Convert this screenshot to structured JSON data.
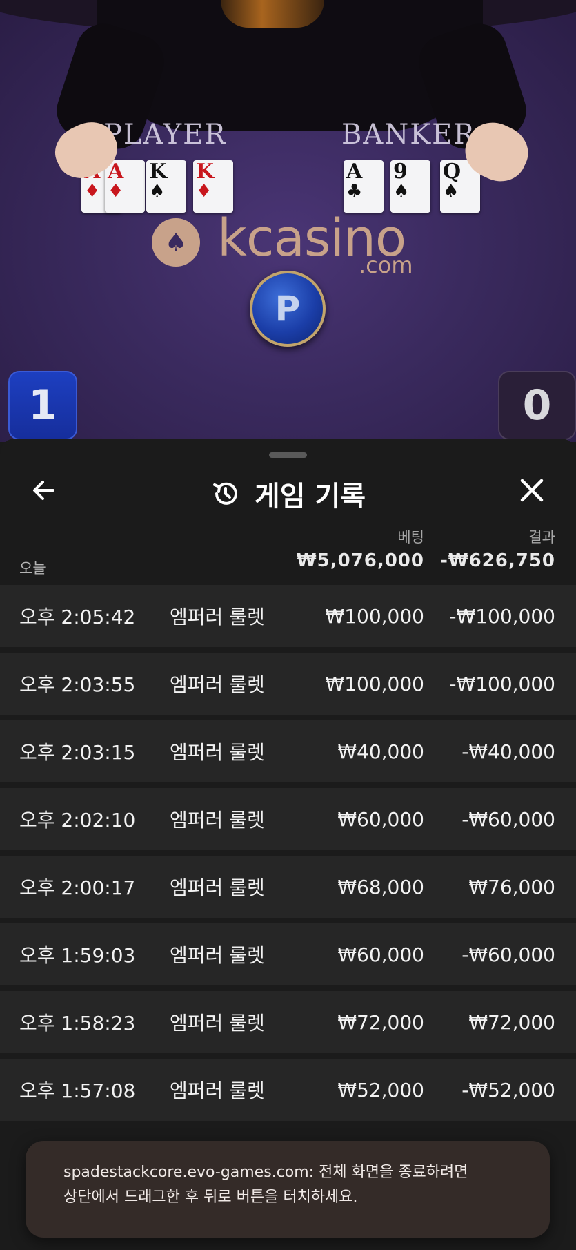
{
  "video": {
    "player_label": "PLAYER",
    "banker_label": "BANKER",
    "player_cards": [
      {
        "rank": "A",
        "suit": "♦",
        "color": "red"
      },
      {
        "rank": "A",
        "suit": "♦",
        "color": "red"
      },
      {
        "rank": "K",
        "suit": "♠",
        "color": "black"
      },
      {
        "rank": "K",
        "suit": "♦",
        "color": "red"
      }
    ],
    "banker_cards": [
      {
        "rank": "A",
        "suit": "♣",
        "color": "black"
      },
      {
        "rank": "9",
        "suit": "♠",
        "color": "black"
      },
      {
        "rank": "Q",
        "suit": "♠",
        "color": "black"
      }
    ],
    "logo_text": "kcasino",
    "logo_suffix": ".com",
    "winner_token": "P",
    "player_score": "1",
    "banker_score": "0"
  },
  "sheet": {
    "title": "게임 기록",
    "history_icon": "history-icon",
    "back_icon": "back-arrow-icon",
    "close_icon": "close-icon",
    "column_bet": "베팅",
    "column_result": "결과",
    "today_label": "오늘",
    "total_bet": "₩5,076,000",
    "total_result": "-₩626,750",
    "rows": [
      {
        "time": "오후 2:05:42",
        "game": "엠퍼러 룰렛",
        "bet": "₩100,000",
        "result": "-₩100,000"
      },
      {
        "time": "오후 2:03:55",
        "game": "엠퍼러 룰렛",
        "bet": "₩100,000",
        "result": "-₩100,000"
      },
      {
        "time": "오후 2:03:15",
        "game": "엠퍼러 룰렛",
        "bet": "₩40,000",
        "result": "-₩40,000"
      },
      {
        "time": "오후 2:02:10",
        "game": "엠퍼러 룰렛",
        "bet": "₩60,000",
        "result": "-₩60,000"
      },
      {
        "time": "오후 2:00:17",
        "game": "엠퍼러 룰렛",
        "bet": "₩68,000",
        "result": "₩76,000"
      },
      {
        "time": "오후 1:59:03",
        "game": "엠퍼러 룰렛",
        "bet": "₩60,000",
        "result": "-₩60,000"
      },
      {
        "time": "오후 1:58:23",
        "game": "엠퍼러 룰렛",
        "bet": "₩72,000",
        "result": "₩72,000"
      },
      {
        "time": "오후 1:57:08",
        "game": "엠퍼러 룰렛",
        "bet": "₩52,000",
        "result": "-₩52,000"
      }
    ]
  },
  "toast": {
    "line1": "spadestackcore.evo-games.com: 전체 화면을 종료하려면",
    "line2": "상단에서 드래그한 후 뒤로 버튼을 터치하세요."
  }
}
